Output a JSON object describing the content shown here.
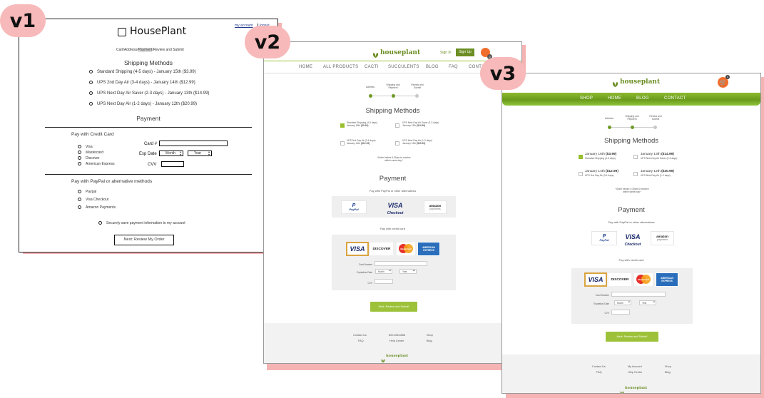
{
  "badges": {
    "v1": "v1",
    "v2": "v2",
    "v3": "v3"
  },
  "colors": {
    "badge": "#f7b9b9",
    "accent_green": "#97bf2c",
    "brand_green": "#6b8e23",
    "cart_orange": "#f06e2d"
  },
  "v1": {
    "logo": "HousePlant",
    "account": "my account",
    "logout": "logout",
    "breadcrumb": {
      "cart": "Cart",
      "address": "Address",
      "payment": "Payment",
      "review": "Review and Submit"
    },
    "shipping_title": "Shipping Methods",
    "shipping_options": [
      "Standard Shipping (4-5 days) - January 15th ($3.99)",
      "UPS 2nd Day Air (3-4 days) - January 14th ($12.99)",
      "UPS Next Day Air Saver (2-3 days) - January 13th ($14.99)",
      "UPS Next Day Air (1-2 days) - January 12th ($20.99)"
    ],
    "payment_title": "Payment",
    "credit_title": "Pay with Credit Card",
    "cards": [
      "Visa",
      "Mastercard",
      "Discover",
      "American Express"
    ],
    "card_label": "Card #",
    "exp_label": "Exp Date",
    "month": "Month",
    "year": "Year",
    "cvv_label": "CVV",
    "alt_title": "Pay with PayPal or alternative methods",
    "alt_methods": [
      "Paypal",
      "Visa Checkout",
      "Amazon Payments"
    ],
    "save_info": "Securely save payment information to my account",
    "next_button": "Next: Review My Order"
  },
  "v2": {
    "logo": "houseplant",
    "sign_in": "Sign In",
    "sign_up": "Sign Up",
    "cart_count": "0",
    "nav": [
      "HOME",
      "ALL PRODUCTS",
      "CACTI",
      "SUCCULENTS",
      "BLOG",
      "FAQ",
      "CONTACT"
    ],
    "steps": [
      "Address",
      "Shipping and Payment",
      "Review and Submit"
    ],
    "shipping_title": "Shipping Methods",
    "shipping": [
      {
        "name": "Standard Shipping (4-5 days)",
        "date": "January 15th",
        "price": "($3.99)"
      },
      {
        "name": "UPS Next Day Air Saver (2-3 days)",
        "date": "January 13th",
        "price": "($14.99)"
      },
      {
        "name": "UPS 2nd Day Air (3-4 days)",
        "date": "January 14th",
        "price": "($12.99)"
      },
      {
        "name": "UPS Next Day Air (1-2 days)",
        "date": "January 12th",
        "price": "($20.99)"
      }
    ],
    "order_note": "*Order before 4:30pm to receive within same day.*",
    "payment_title": "Payment",
    "alt_label": "Pay with PayPal or other alternatives",
    "credit_label": "Pay with credit card",
    "card_number": "Card Number",
    "exp_date": "Expiration Date",
    "month": "Month",
    "year": "Year",
    "cvv": "CVV",
    "submit": "Next: Review and Submit",
    "footer": {
      "contact": "Contact Us",
      "phone": "800.656.6566",
      "shop": "Shop",
      "faq": "FAQ",
      "help": "Help Center",
      "blog": "Blog"
    }
  },
  "v3": {
    "logo": "houseplant",
    "cart_count": "0",
    "nav": [
      "SHOP",
      "HOME",
      "BLOG",
      "CONTACT"
    ],
    "steps": [
      "Address",
      "Shipping and Payment",
      "Review and Submit"
    ],
    "shipping_title": "Shipping Methods",
    "shipping": [
      {
        "date": "January 15th",
        "price": "($3.99)",
        "name": "Standard Shipping (4-5 days)"
      },
      {
        "date": "January 13th",
        "price": "($14.99)",
        "name": "UPS Next Day Air Saver (2-3 days)"
      },
      {
        "date": "January 14th",
        "price": "($12.99)",
        "name": "UPS 2nd Day Air (3-4 days)"
      },
      {
        "date": "January 12th",
        "price": "($20.99)",
        "name": "UPS Next Day Air (1-2 days)"
      }
    ],
    "order_note": "*Order before 4:30pm to receive within same day.*",
    "payment_title": "Payment",
    "alt_label": "Pay with PayPal or other alternatives",
    "credit_label": "Pay with credit card",
    "card_number": "Card Number",
    "exp_date": "Expiration Date",
    "month": "Month",
    "year": "Year",
    "cvv": "CVV",
    "submit": "Next: Review and Submit",
    "footer": {
      "contact": "Contact Us",
      "account": "My Account",
      "shop": "Shop",
      "faq": "FAQ",
      "help": "Help Center",
      "blog": "Blog"
    }
  },
  "brands": {
    "paypal": "PayPal",
    "visa": "VISA",
    "checkout": "Checkout",
    "amazon": "amazon",
    "payments": "payments",
    "discover": "DISCOVER",
    "mastercard": "MasterCard",
    "amex1": "AMERICAN",
    "amex2": "EXPRESS"
  }
}
